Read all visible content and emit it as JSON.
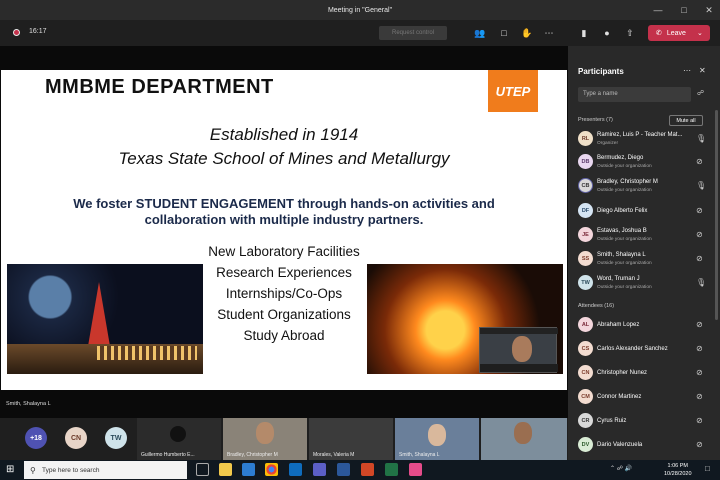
{
  "window": {
    "title": "Meeting in \"General\""
  },
  "toolbar": {
    "timer": "16:17",
    "request_control": "Request control",
    "leave": "Leave"
  },
  "slide": {
    "title": "MMBME DEPARTMENT",
    "logo": "UTEP",
    "established": "Established in 1914",
    "school": "Texas State School of Mines and Metallurgy",
    "engagement_line1": "We foster STUDENT ENGAGEMENT through hands-on activities and",
    "engagement_line2": "collaboration with multiple industry partners.",
    "bullets": [
      "New Laboratory Facilities",
      "Research Experiences",
      "Internships/Co-Ops",
      "Student Organizations",
      "Study Abroad"
    ]
  },
  "stage": {
    "presenter_label": "Smith, Shalayna L"
  },
  "gallery": {
    "overflow": "+18",
    "avatars": [
      {
        "initials": "CN",
        "color": "#e8d5c8"
      },
      {
        "initials": "TW",
        "color": "#cfe3ea"
      }
    ],
    "tiles": [
      "Guillermo Humberto E...",
      "Bradley, Christopher M",
      "Morales, Valeria M",
      "Smith, Shalayna L"
    ]
  },
  "participants": {
    "header": "Participants",
    "search_placeholder": "Type a name",
    "presenters_label": "Presenters (7)",
    "mute_all": "Mute all",
    "presenters": [
      {
        "initials": "RL",
        "name": "Ramirez, Luis P - Teacher Mat...",
        "sub": "Organizer",
        "color": "#f0e0c8"
      },
      {
        "initials": "DB",
        "name": "Bermudez, Diego",
        "sub": "Outside your organization",
        "color": "#e9d7f0"
      },
      {
        "initials": "CB",
        "name": "Bradley, Christopher M",
        "sub": "Outside your organization",
        "color": "#d8d8d8"
      },
      {
        "initials": "DF",
        "name": "Diego Alberto Felix",
        "sub": "",
        "color": "#d5e4f3"
      },
      {
        "initials": "JE",
        "name": "Estavas, Joshua B",
        "sub": "Outside your organization",
        "color": "#f3d6dc"
      },
      {
        "initials": "SS",
        "name": "Smith, Shalayna L",
        "sub": "Outside your organization",
        "color": "#f3dcd0"
      },
      {
        "initials": "TW",
        "name": "Word, Truman J",
        "sub": "Outside your organization",
        "color": "#cfe3ea"
      }
    ],
    "attendees_label": "Attendees (16)",
    "attendees": [
      {
        "initials": "AL",
        "name": "Abraham Lopez",
        "color": "#f3d6dc"
      },
      {
        "initials": "CS",
        "name": "Carlos Alexander Sanchez",
        "color": "#f3dcd0"
      },
      {
        "initials": "CN",
        "name": "Christopher Nunez",
        "color": "#f3dcd0"
      },
      {
        "initials": "CM",
        "name": "Connor Martinez",
        "color": "#f3dcd0"
      },
      {
        "initials": "CR",
        "name": "Cyrus Ruiz",
        "color": "#d8d8d8"
      },
      {
        "initials": "DV",
        "name": "Dario Valenzuela",
        "color": "#d9ecd5"
      }
    ]
  },
  "taskbar": {
    "search_placeholder": "Type here to search",
    "time": "1:06 PM",
    "date": "10/28/2020"
  }
}
